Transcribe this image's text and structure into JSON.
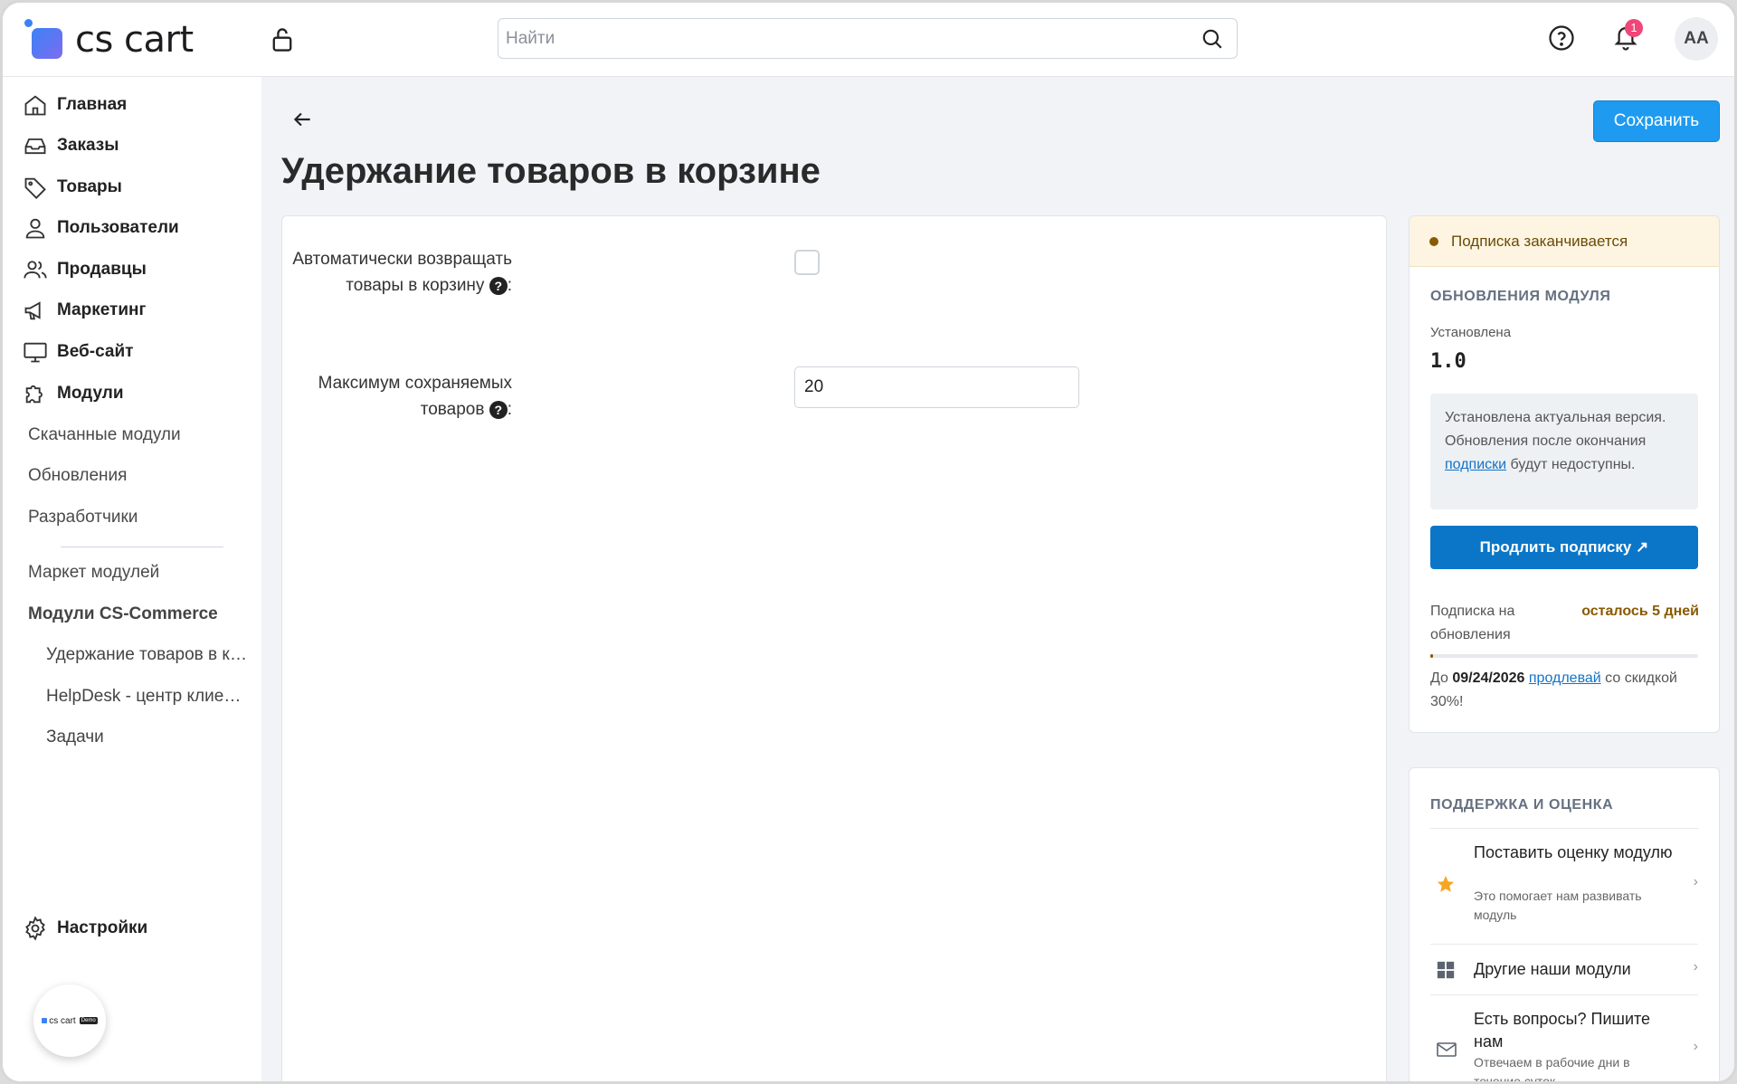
{
  "header": {
    "logo_text": "cs cart",
    "search_placeholder": "Найти",
    "notification_count": "1",
    "avatar_initials": "AA"
  },
  "sidebar": {
    "main_items": [
      {
        "label": "Главная",
        "icon": "home-icon"
      },
      {
        "label": "Заказы",
        "icon": "inbox-icon"
      },
      {
        "label": "Товары",
        "icon": "tag-icon"
      },
      {
        "label": "Пользователи",
        "icon": "user-icon"
      },
      {
        "label": "Продавцы",
        "icon": "users-icon"
      },
      {
        "label": "Маркетинг",
        "icon": "megaphone-icon"
      },
      {
        "label": "Веб-сайт",
        "icon": "monitor-icon"
      },
      {
        "label": "Модули",
        "icon": "puzzle-icon"
      }
    ],
    "sub_items": [
      "Скачанные модули",
      "Обновления",
      "Разработчики"
    ],
    "market_label": "Маркет модулей",
    "group_label": "Модули CS-Commerce",
    "group_items": [
      "Удержание товаров в корзине",
      "HelpDesk - центр клиентской поддержки",
      "Задачи"
    ],
    "settings_label": "Настройки",
    "demo_logo": "cs cart",
    "demo_tag": "Demo"
  },
  "page": {
    "title": "Удержание товаров в корзине",
    "save_label": "Сохранить"
  },
  "form": {
    "auto_return_label": "Автоматически возвращать товары в корзину",
    "auto_return_checked": false,
    "max_items_label": "Максимум сохраняемых товаров",
    "max_items_value": "20",
    "colon": ":"
  },
  "subscription": {
    "warning": "Подписка заканчивается",
    "heading": "ОБНОВЛЕНИЯ МОДУЛЯ",
    "installed_label": "Установлена",
    "installed_version": "1.0",
    "info_before": "Установлена актуальная версия. Обновления после окончания ",
    "info_link": "подписки",
    "info_after": " будут недоступны.",
    "renew_label": "Продлить подписку ↗",
    "sub_label": "Подписка на обновления",
    "days_left": "осталось 5 дней",
    "progress_fraction": 0.01,
    "until_prefix": "До ",
    "until_date": "09/24/2026",
    "renew_link": "продлевай",
    "until_suffix": " со скидкой 30%!"
  },
  "support": {
    "heading": "ПОДДЕРЖКА И ОЦЕНКА",
    "items": [
      {
        "title": "Поставить оценку модулю",
        "subtitle": "Это помогает нам развивать модуль",
        "icon": "star-icon"
      },
      {
        "title": "Другие наши модули",
        "subtitle": "",
        "icon": "grid-icon"
      },
      {
        "title": "Есть вопросы? Пишите нам",
        "subtitle": "Отвечаем в рабочие дни в течение суток",
        "icon": "mail-icon"
      }
    ]
  },
  "colors": {
    "accent": "#1e9bf0",
    "renew_button": "#0b76c7",
    "warning_bg": "#fdf5e2",
    "warning_text": "#8a5a00",
    "notification_badge": "#f0467a"
  }
}
